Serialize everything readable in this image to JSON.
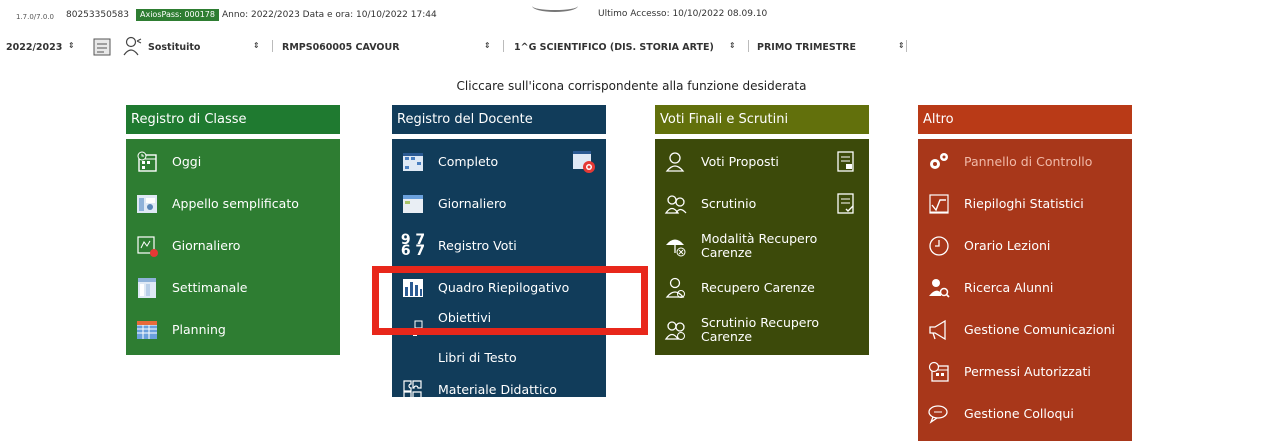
{
  "topline": {
    "version": "1.7.0/7.0.0",
    "code": "80253350583",
    "pass": "AxiosPass: 000178",
    "anno": "Anno: 2022/2023  Data e ora: 10/10/2022 17:44",
    "last_access": "Ultimo Accesso: 10/10/2022 08.09.10"
  },
  "selectors": {
    "year": "2022/2023",
    "role": "Sostituito",
    "school": "RMPS060005 CAVOUR",
    "class": "1^G SCIENTIFICO (DIS. STORIA ARTE)",
    "period": "PRIMO TRIMESTRE"
  },
  "instruction": "Cliccare sull'icona corrispondente alla funzione desiderata",
  "columns": [
    {
      "title": "Registro di Classe",
      "items": [
        {
          "label": "Oggi",
          "icon": "calendar-clock-icon"
        },
        {
          "label": "Appello semplificato",
          "icon": "attendance-icon"
        },
        {
          "label": "Giornaliero",
          "icon": "daily-register-icon"
        },
        {
          "label": "Settimanale",
          "icon": "weekly-icon"
        },
        {
          "label": "Planning",
          "icon": "planning-grid-icon"
        }
      ]
    },
    {
      "title": "Registro del Docente",
      "items": [
        {
          "label": "Completo",
          "icon": "grid-register-icon",
          "right_icon": "grid-target-icon"
        },
        {
          "label": "Giornaliero",
          "icon": "window-icon"
        },
        {
          "label": "Registro Voti",
          "icon": "numbers-icon"
        },
        {
          "label": "Quadro Riepilogativo",
          "icon": "bar-chart-icon"
        },
        {
          "label": "Obiettivi",
          "icon": "objectives-icon"
        },
        {
          "label": "Libri di Testo",
          "icon": "books-icon"
        },
        {
          "label": "Materiale Didattico",
          "icon": "puzzle-icon"
        }
      ]
    },
    {
      "title": "Voti Finali e Scrutini",
      "items": [
        {
          "label": "Voti Proposti",
          "icon": "person-icon",
          "right_icon": "document-icon"
        },
        {
          "label": "Scrutinio",
          "icon": "group-icon",
          "right_icon": "document-check-icon"
        },
        {
          "label": "Modalità Recupero Carenze",
          "icon": "umbrella-icon"
        },
        {
          "label": "Recupero Carenze",
          "icon": "person-refresh-icon"
        },
        {
          "label": "Scrutinio Recupero Carenze",
          "icon": "group-refresh-icon"
        }
      ]
    },
    {
      "title": "Altro",
      "items": [
        {
          "label": "Pannello di Controllo",
          "icon": "gears-icon",
          "disabled": true
        },
        {
          "label": "Riepiloghi Statistici",
          "icon": "chart-line-icon"
        },
        {
          "label": "Orario Lezioni",
          "icon": "clock-icon"
        },
        {
          "label": "Ricerca Alunni",
          "icon": "user-search-icon"
        },
        {
          "label": "Gestione Comunicazioni",
          "icon": "megaphone-icon"
        },
        {
          "label": "Permessi Autorizzati",
          "icon": "calendar-permit-icon"
        },
        {
          "label": "Gestione Colloqui",
          "icon": "chat-icon"
        }
      ]
    }
  ],
  "colors": {
    "registro_classe": "#2e7d32",
    "registro_docente": "#113c5a",
    "voti_finali": "#3c4a0a",
    "altro": "#a8371a",
    "highlight": "#e8271b"
  }
}
